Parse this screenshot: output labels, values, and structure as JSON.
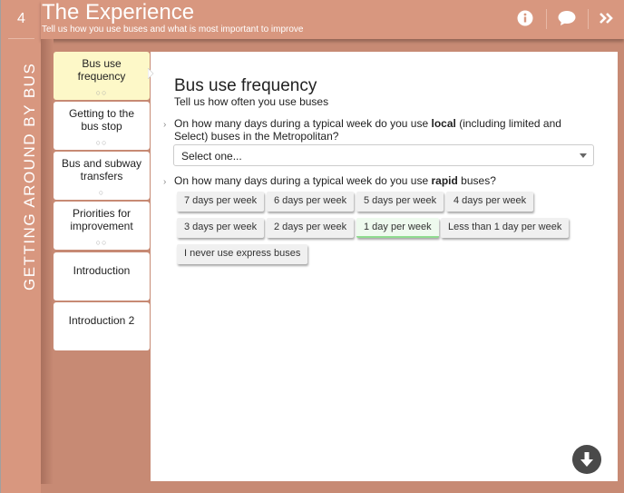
{
  "header": {
    "step_number": "4",
    "title": "The Experience",
    "subtitle": "Tell us how you use buses and what is most important to improve",
    "icons": [
      "info-icon",
      "comment-icon",
      "next-icon"
    ]
  },
  "section_label": "GETTING AROUND BY BUS",
  "nav": {
    "items": [
      {
        "label": "Bus use frequency",
        "dots": "○○",
        "active": true
      },
      {
        "label": "Getting to the bus stop",
        "dots": "○○",
        "active": false
      },
      {
        "label": "Bus and subway transfers",
        "dots": "○",
        "active": false
      },
      {
        "label": "Priorities for improvement",
        "dots": "○○",
        "active": false
      },
      {
        "label": "Introduction",
        "dots": "",
        "active": false
      },
      {
        "label": "Introduction 2",
        "dots": "",
        "active": false
      }
    ]
  },
  "main": {
    "title": "Bus use frequency",
    "subtitle": "Tell us how often you use buses",
    "question1": {
      "prefix": "On how many days during a typical week do you use ",
      "bold": "local",
      "suffix_line1": " (including limited and",
      "line2": "Select) buses in the Metropolitan?",
      "select_value": "Select one..."
    },
    "question2": {
      "prefix": "On how many days during a typical week do you use ",
      "bold": "rapid",
      "suffix": " buses?",
      "options": [
        {
          "label": "7 days per week",
          "selected": false
        },
        {
          "label": "6 days per week",
          "selected": false
        },
        {
          "label": "5 days per week",
          "selected": false
        },
        {
          "label": "4 days per week",
          "selected": false
        },
        {
          "label": "3 days per week",
          "selected": false
        },
        {
          "label": "2 days per week",
          "selected": false
        },
        {
          "label": "1 day per week",
          "selected": true
        },
        {
          "label": "Less than 1 day per week",
          "selected": false
        },
        {
          "label": "I never use express buses",
          "selected": false
        }
      ]
    }
  },
  "colors": {
    "brand": "#d8977f",
    "brand_dark": "#c78a74",
    "active_nav": "#fdf8c8",
    "selected_option_accent": "#8fdc8f"
  }
}
